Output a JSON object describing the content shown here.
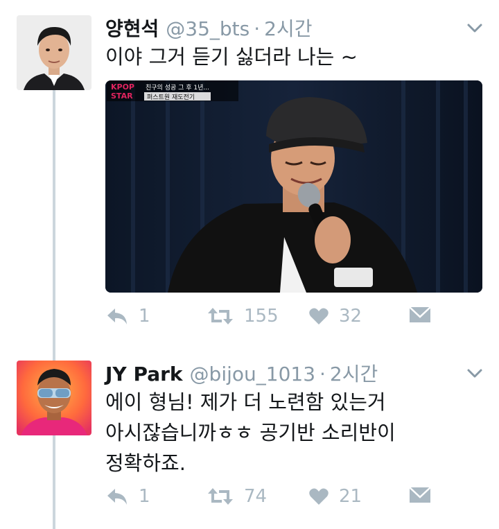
{
  "tweets": [
    {
      "author_name": "양현석",
      "handle": "@35_bts",
      "separator": "·",
      "time": "2시간",
      "text": "이야 그거 듣기 싫더라 나는 ~",
      "media": {
        "overlay_lines": [
          "KPOP",
          "STAR",
          "친구의 성공 그 후 1년...",
          "퍼스트원 재도전기"
        ]
      },
      "actions": {
        "reply_count": "1",
        "retweet_count": "155",
        "like_count": "32"
      }
    },
    {
      "author_name": "JY Park",
      "handle": "@bijou_1013",
      "separator": "·",
      "time": "2시간",
      "text_lines": [
        "에이 형님! 제가 더 노련함 있는거",
        "아시잖습니까ㅎㅎ 공기반 소리반이",
        "정확하죠."
      ],
      "actions": {
        "reply_count": "1",
        "retweet_count": "74",
        "like_count": "21"
      }
    }
  ],
  "icons": {
    "reply": "reply-icon",
    "retweet": "retweet-icon",
    "like": "heart-icon",
    "message": "envelope-icon",
    "menu": "chevron-down-icon"
  },
  "colors": {
    "text": "#14171a",
    "secondary": "#8899a6",
    "action": "#aab8c2",
    "thread_line": "#ccd6dd",
    "media_accent": "#e0245e"
  }
}
